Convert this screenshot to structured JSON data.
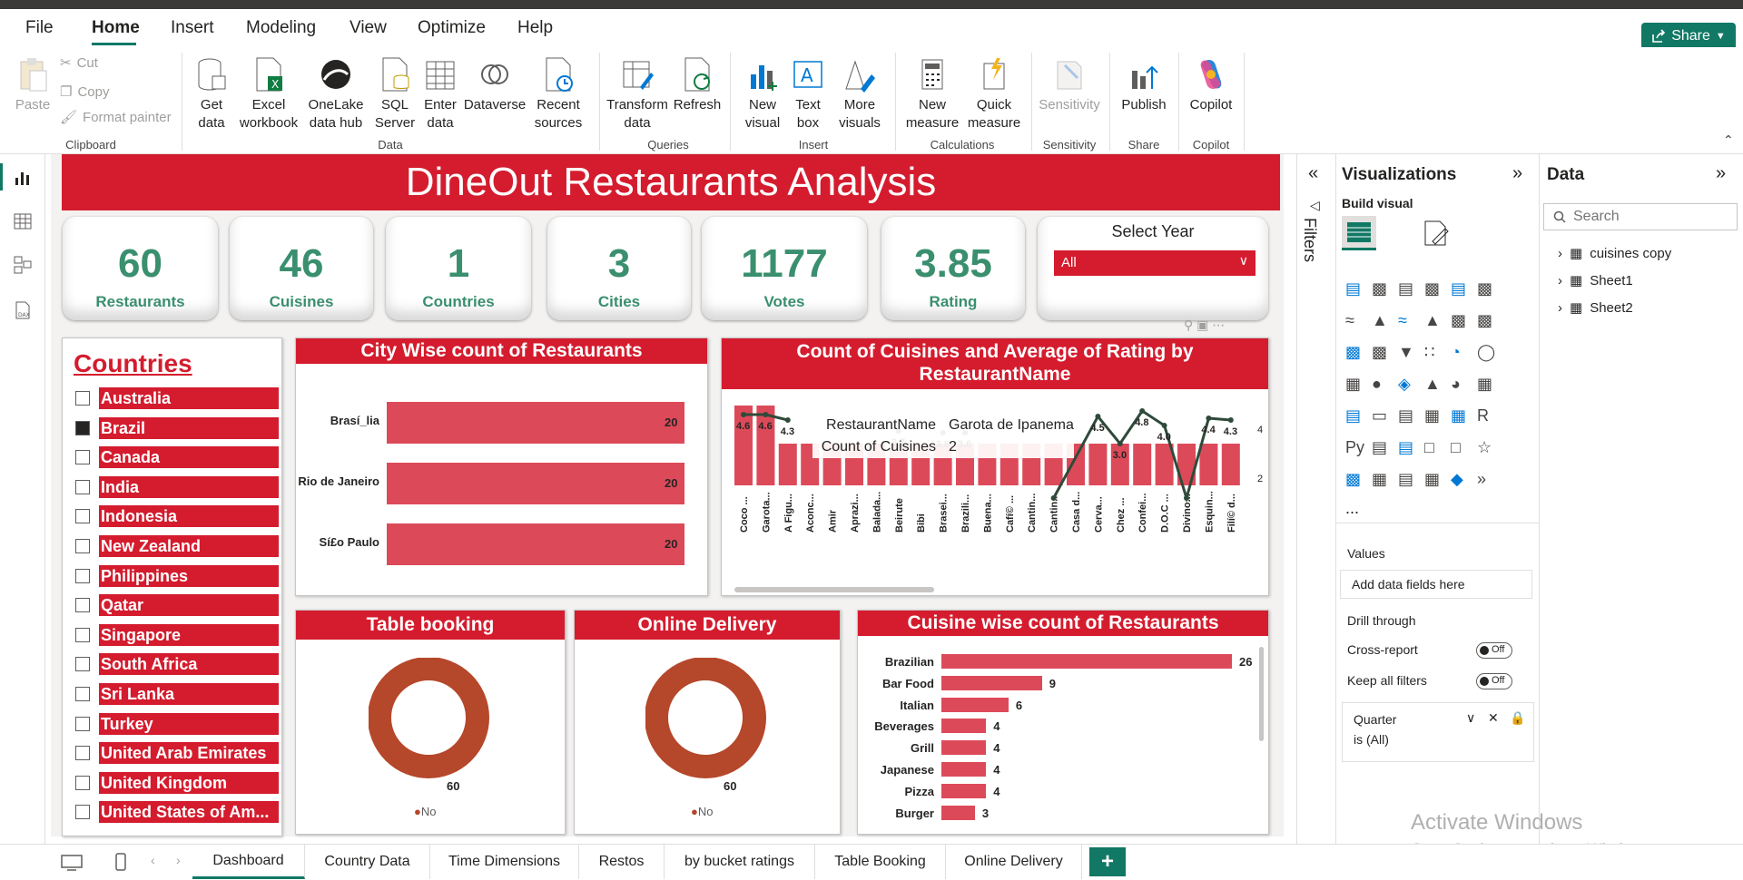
{
  "menu": {
    "items": [
      "File",
      "Home",
      "Insert",
      "Modeling",
      "View",
      "Optimize",
      "Help"
    ],
    "share_label": "Share"
  },
  "ribbon": {
    "clipboard": {
      "paste": "Paste",
      "cut": "Cut",
      "copy": "Copy",
      "format_painter": "Format painter",
      "group": "Clipboard"
    },
    "data": {
      "get_data": "Get data",
      "excel": "Excel workbook",
      "onelake": "OneLake data hub",
      "sql": "SQL Server",
      "enter": "Enter data",
      "dataverse": "Dataverse",
      "recent": "Recent sources",
      "group": "Data"
    },
    "queries": {
      "transform": "Transform data",
      "refresh": "Refresh",
      "group": "Queries"
    },
    "insert": {
      "new_visual": "New visual",
      "text_box": "Text box",
      "more_visuals": "More visuals",
      "group": "Insert"
    },
    "calculations": {
      "new_measure": "New measure",
      "quick_measure": "Quick measure",
      "group": "Calculations"
    },
    "sensitivity": {
      "label": "Sensitivity",
      "group": "Sensitivity"
    },
    "share": {
      "publish": "Publish",
      "group": "Share"
    },
    "copilot": {
      "label": "Copilot",
      "group": "Copilot"
    }
  },
  "report": {
    "title": "DineOut Restaurants Analysis",
    "kpis": [
      {
        "value": "60",
        "label": "Restaurants"
      },
      {
        "value": "46",
        "label": "Cuisines"
      },
      {
        "value": "1",
        "label": "Countries"
      },
      {
        "value": "3",
        "label": "Cities"
      },
      {
        "value": "1177",
        "label": "Votes"
      },
      {
        "value": "3.85",
        "label": "Rating"
      }
    ],
    "year_slicer": {
      "title": "Select Year",
      "value": "All"
    },
    "countries": {
      "title": "Countries",
      "items": [
        {
          "name": "Australia",
          "checked": false
        },
        {
          "name": "Brazil",
          "checked": true
        },
        {
          "name": "Canada",
          "checked": false
        },
        {
          "name": "India",
          "checked": false
        },
        {
          "name": "Indonesia",
          "checked": false
        },
        {
          "name": "New Zealand",
          "checked": false
        },
        {
          "name": "Philippines",
          "checked": false
        },
        {
          "name": "Qatar",
          "checked": false
        },
        {
          "name": "Singapore",
          "checked": false
        },
        {
          "name": "South Africa",
          "checked": false
        },
        {
          "name": "Sri Lanka",
          "checked": false
        },
        {
          "name": "Turkey",
          "checked": false
        },
        {
          "name": "United Arab Emirates",
          "checked": false
        },
        {
          "name": "United Kingdom",
          "checked": false
        },
        {
          "name": "United States of Am...",
          "checked": false
        }
      ]
    },
    "city_chart": {
      "title": "City Wise count of Restaurants",
      "categories": [
        "Brasí_lia",
        "Rio de Janeiro",
        "Sí£o Paulo"
      ],
      "values": [
        20,
        20,
        20
      ],
      "max": 20
    },
    "combo_chart": {
      "title": "Count of Cuisines and Average of Rating by RestaurantName",
      "categories": [
        "Coco ...",
        "Garota...",
        "A Figu...",
        "Aconc...",
        "Amir",
        "Aprazi...",
        "Balada...",
        "Beirute",
        "Bibi",
        "Brasei...",
        "Brazili...",
        "Buena...",
        "Cafí© ...",
        "Cantin...",
        "Cantin...",
        "Casa d...",
        "Cerva...",
        "Chez ...",
        "Confei...",
        "D.O.C ...",
        "Divino...",
        "Esquin...",
        "Filí© d..."
      ],
      "ratings": [
        4.6,
        4.6,
        4.3,
        null,
        null,
        null,
        null,
        3.7,
        null,
        3.6,
        3.6,
        null,
        null,
        null,
        0.0,
        null,
        4.5,
        3.0,
        4.8,
        4.0,
        0.0,
        4.4,
        4.3
      ],
      "rating_labels": [
        "4.6",
        "4.6",
        "4.3",
        "3.7",
        "3.6",
        "3.6",
        "4.5",
        "3.0",
        "4.8",
        "4.0",
        "4.4",
        "4.3"
      ],
      "right_axis_labels": [
        "4",
        "2"
      ],
      "tooltip": {
        "k1": "RestaurantName",
        "v1": "Garota de Ipanema",
        "k2": "Count of Cuisines",
        "v2": "2"
      }
    },
    "table_booking": {
      "title": "Table booking",
      "value": "60",
      "legend": "No"
    },
    "online_delivery": {
      "title": "Online Delivery",
      "value": "60",
      "legend": "No"
    },
    "cuisine_chart": {
      "title": "Cuisine wise count of Restaurants",
      "categories": [
        "Brazilian",
        "Bar Food",
        "Italian",
        "Beverages",
        "Grill",
        "Japanese",
        "Pizza",
        "Burger"
      ],
      "values": [
        26,
        9,
        6,
        4,
        4,
        4,
        4,
        3
      ],
      "max": 26
    }
  },
  "filters_label": "Filters",
  "visualizations": {
    "title": "Visualizations",
    "build_visual": "Build visual",
    "values_label": "Values",
    "add_fields": "Add data fields here",
    "drill_through": "Drill through",
    "cross_report": "Cross-report",
    "keep_filters": "Keep all filters",
    "toggle_off": "Off",
    "filter_card": {
      "field": "Quarter",
      "state": "is (All)"
    },
    "more": "..."
  },
  "data_pane": {
    "title": "Data",
    "search_placeholder": "Search",
    "tables": [
      "cuisines copy",
      "Sheet1",
      "Sheet2"
    ]
  },
  "page_tabs": [
    "Dashboard",
    "Country Data",
    "Time Dimensions",
    "Restos",
    "by bucket ratings",
    "Table Booking",
    "Online Delivery"
  ],
  "add_page": "+",
  "watermark": {
    "line1": "Activate Windows",
    "line2": "Go to Settings to activate Windows."
  },
  "colors": {
    "accent": "#117865",
    "brand_red": "#d41c2e",
    "bar_red": "#dc4a5a",
    "kpi_green": "#3a8f6f",
    "donut": "#b5472a",
    "line": "#2f4a3a"
  }
}
